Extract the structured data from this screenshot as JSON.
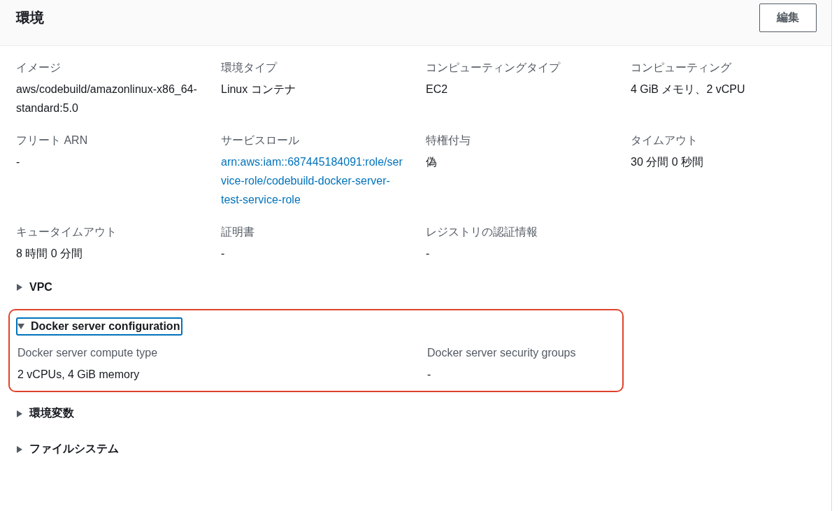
{
  "header": {
    "title": "環境",
    "edit_button": "編集"
  },
  "fields": [
    {
      "label": "イメージ",
      "value": "aws/codebuild/amazonlinux-x86_64-standard:5.0",
      "kind": "text"
    },
    {
      "label": "環境タイプ",
      "value": "Linux コンテナ",
      "kind": "text"
    },
    {
      "label": "コンピューティングタイプ",
      "value": "EC2",
      "kind": "text"
    },
    {
      "label": "コンピューティング",
      "value": "4 GiB メモリ、2 vCPU",
      "kind": "text"
    },
    {
      "label": "フリート ARN",
      "value": "-",
      "kind": "text"
    },
    {
      "label": "サービスロール",
      "value": "arn:aws:iam::687445184091:role/service-role/codebuild-docker-server-test-service-role",
      "kind": "link"
    },
    {
      "label": "特権付与",
      "value": "偽",
      "kind": "text"
    },
    {
      "label": "タイムアウト",
      "value": "30 分間 0 秒間",
      "kind": "text"
    },
    {
      "label": "キュータイムアウト",
      "value": "8 時間 0 分間",
      "kind": "text"
    },
    {
      "label": "証明書",
      "value": "-",
      "kind": "text"
    },
    {
      "label": "レジストリの認証情報",
      "value": "-",
      "kind": "text"
    }
  ],
  "sections": [
    {
      "label": "VPC",
      "expanded": false,
      "focused": false,
      "highlighted": false
    },
    {
      "label": "Docker server configuration",
      "expanded": true,
      "focused": true,
      "highlighted": true,
      "fields": [
        {
          "label": "Docker server compute type",
          "value": "2 vCPUs, 4 GiB memory",
          "kind": "text"
        },
        {
          "label": "Docker server security groups",
          "value": "-",
          "kind": "text"
        }
      ]
    },
    {
      "label": "環境変数",
      "expanded": false,
      "focused": false,
      "highlighted": false
    },
    {
      "label": "ファイルシステム",
      "expanded": false,
      "focused": false,
      "highlighted": false
    }
  ]
}
